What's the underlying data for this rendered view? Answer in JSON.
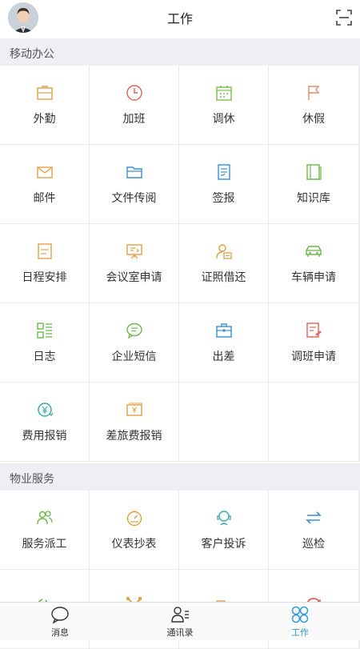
{
  "header": {
    "title": "工作"
  },
  "sections": [
    {
      "title": "移动办公",
      "items": [
        {
          "label": "外勤",
          "icon": "briefcase-icon",
          "color": "#e0a148"
        },
        {
          "label": "加班",
          "icon": "clock-icon",
          "color": "#e0605a"
        },
        {
          "label": "调休",
          "icon": "calendar-icon",
          "color": "#7cbf52"
        },
        {
          "label": "休假",
          "icon": "flag-icon",
          "color": "#e08c6c"
        },
        {
          "label": "邮件",
          "icon": "mail-icon",
          "color": "#e0a148"
        },
        {
          "label": "文件传阅",
          "icon": "folder-icon",
          "color": "#3a8fd6"
        },
        {
          "label": "签报",
          "icon": "document-icon",
          "color": "#3a8fd6"
        },
        {
          "label": "知识库",
          "icon": "book-icon",
          "color": "#6db84a"
        },
        {
          "label": "日程安排",
          "icon": "schedule-icon",
          "color": "#e0a148"
        },
        {
          "label": "会议室申请",
          "icon": "presentation-icon",
          "color": "#e0a148"
        },
        {
          "label": "证照借还",
          "icon": "id-card-icon",
          "color": "#e0a148"
        },
        {
          "label": "车辆申请",
          "icon": "car-icon",
          "color": "#6db84a"
        },
        {
          "label": "日志",
          "icon": "list-icon",
          "color": "#6db84a"
        },
        {
          "label": "企业短信",
          "icon": "message-icon",
          "color": "#6db84a"
        },
        {
          "label": "出差",
          "icon": "suitcase-icon",
          "color": "#3a8fd6"
        },
        {
          "label": "调班申请",
          "icon": "shift-icon",
          "color": "#e0605a"
        },
        {
          "label": "费用报销",
          "icon": "yen-icon",
          "color": "#3aa7a8"
        },
        {
          "label": "差旅费报销",
          "icon": "yen-bill-icon",
          "color": "#e0a148"
        }
      ]
    },
    {
      "title": "物业服务",
      "items": [
        {
          "label": "服务派工",
          "icon": "users-icon",
          "color": "#6db84a"
        },
        {
          "label": "仪表抄表",
          "icon": "gauge-icon",
          "color": "#e0a148"
        },
        {
          "label": "客户投诉",
          "icon": "complaint-icon",
          "color": "#3aa7a8"
        },
        {
          "label": "巡检",
          "icon": "swap-icon",
          "color": "#3a8fd6"
        },
        {
          "label": "",
          "icon": "signal-icon",
          "color": "#6db84a"
        },
        {
          "label": "",
          "icon": "tools-icon",
          "color": "#e0a148"
        },
        {
          "label": "",
          "icon": "package-icon",
          "color": "#e0a148"
        },
        {
          "label": "",
          "icon": "refresh-icon",
          "color": "#e0605a"
        }
      ]
    }
  ],
  "tabbar": [
    {
      "label": "消息",
      "icon": "chat-icon",
      "active": false
    },
    {
      "label": "通讯录",
      "icon": "contacts-icon",
      "active": false
    },
    {
      "label": "工作",
      "icon": "apps-icon",
      "active": true
    }
  ],
  "colors": {
    "accent": "#2d9cdb",
    "section_bg": "#eeeef3"
  }
}
